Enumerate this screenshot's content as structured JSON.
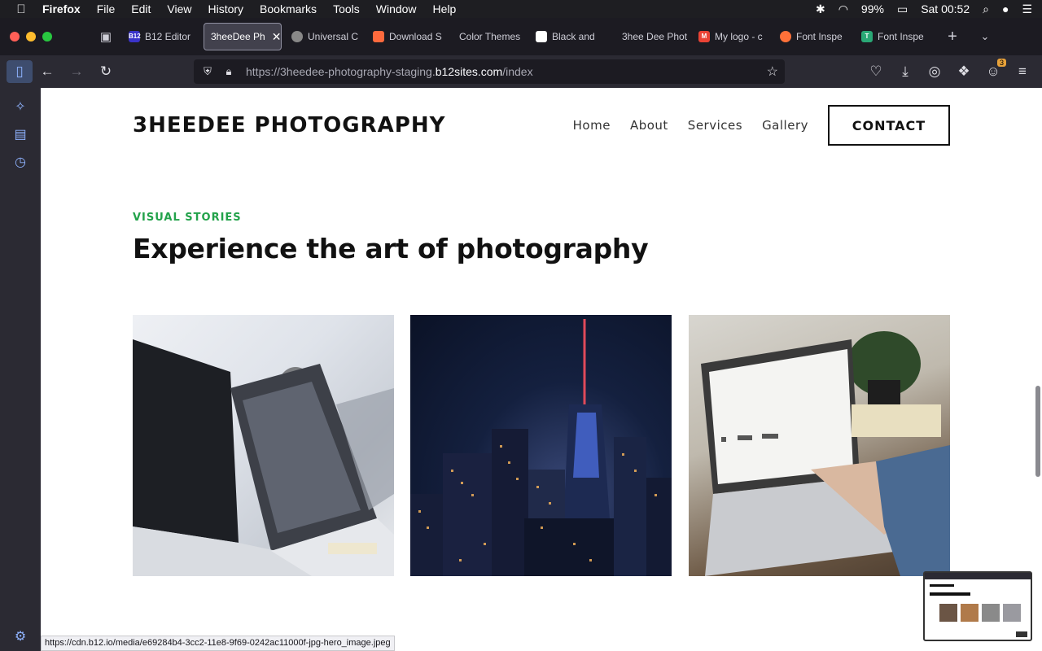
{
  "menubar": {
    "app": "Firefox",
    "items": [
      "File",
      "Edit",
      "View",
      "History",
      "Bookmarks",
      "Tools",
      "Window",
      "Help"
    ],
    "battery": "99%",
    "clock": "Sat 00:52"
  },
  "tabs": [
    {
      "label": "B12 Editor",
      "fav_color": "#3a33c9",
      "fav_text": "B12"
    },
    {
      "label": "3heeDee Ph",
      "fav_color": "",
      "fav_text": "",
      "active": true
    },
    {
      "label": "Universal C",
      "fav_color": "#888888",
      "fav_text": ""
    },
    {
      "label": "Download S",
      "fav_color": "#ff6a3d",
      "fav_text": ""
    },
    {
      "label": "Color Themes",
      "fav_color": "",
      "fav_text": ""
    },
    {
      "label": "Black and",
      "fav_color": "#ffffff",
      "fav_text": ""
    },
    {
      "label": "3hee Dee Phot",
      "fav_color": "",
      "fav_text": ""
    },
    {
      "label": "My logo - c",
      "fav_color": "#ea4335",
      "fav_text": "M"
    },
    {
      "label": "Font Inspe",
      "fav_color": "#ff7139",
      "fav_text": ""
    },
    {
      "label": "Font Inspe",
      "fav_color": "#2aa876",
      "fav_text": "T"
    }
  ],
  "toolbar": {
    "url_prefix": "https://3heedee-photography-staging.",
    "url_domain": "b12sites.com",
    "url_path": "/index",
    "extension_badge": "3"
  },
  "site": {
    "logo": "3HEEDEE PHOTOGRAPHY",
    "nav": [
      "Home",
      "About",
      "Services",
      "Gallery"
    ],
    "contact": "CONTACT",
    "eyebrow": "VISUAL STORIES",
    "headline": "Experience the art of photography"
  },
  "status_url": "https://cdn.b12.io/media/e69284b4-3cc2-11e8-9f69-0242ac11000f-jpg-hero_image.jpeg",
  "colors": {
    "accent_green": "#22a24a",
    "browser_dark": "#1c1b22",
    "toolbar": "#2b2a33"
  }
}
